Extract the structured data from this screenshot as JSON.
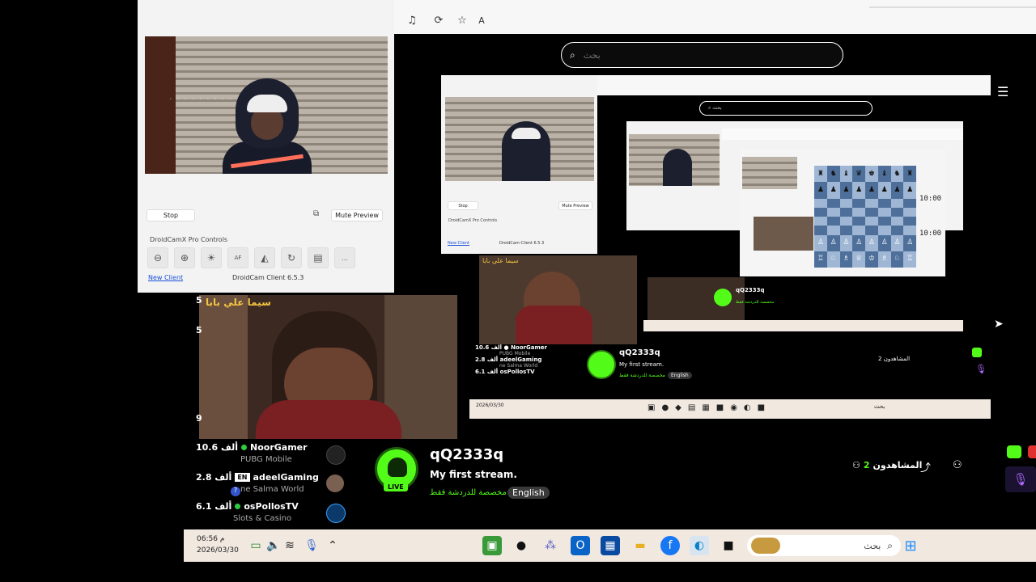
{
  "droidcam": {
    "stop_label": "Stop",
    "mute_label": "Mute Preview",
    "controls_label": "DroidCamX Pro Controls",
    "new_client_label": "New Client",
    "version_label": "DroidCam Client 6.5.3",
    "af_label": "AF"
  },
  "browser": {
    "search_placeholder": "بحث",
    "nested_search_placeholder": "بحث"
  },
  "chess": {
    "clock_top": "10:00",
    "clock_bottom": "10:00"
  },
  "video": {
    "channel_watermark": "سيما علي بابا"
  },
  "recommended": [
    {
      "count": "10.6 ألف",
      "name": "NoorGamer",
      "game": "PUBG Mobile"
    },
    {
      "count": "2.8 ألف",
      "name": "adeelGaming",
      "game": "ne Salma World"
    },
    {
      "count": "6.1 ألف",
      "name": "osPollosTV",
      "game": "Slots & Casino"
    }
  ],
  "lang_badge": "EN",
  "side_numbers": [
    "5",
    "5",
    "9"
  ],
  "stream": {
    "channel": "qQ2333q",
    "title": "My first stream.",
    "tag": "مخصصة للدردشة فقط",
    "language": "English",
    "live_label": "LIVE",
    "viewers_label": "المشاهدون",
    "viewers_count": "2"
  },
  "taskbar": {
    "time": "06:56 م",
    "date": "2026/03/30",
    "search_placeholder": "بحث"
  },
  "colors": {
    "accent_green": "#53fc18",
    "taskbar_bg": "#f1e8e0",
    "link_blue": "#1a4fd8"
  }
}
